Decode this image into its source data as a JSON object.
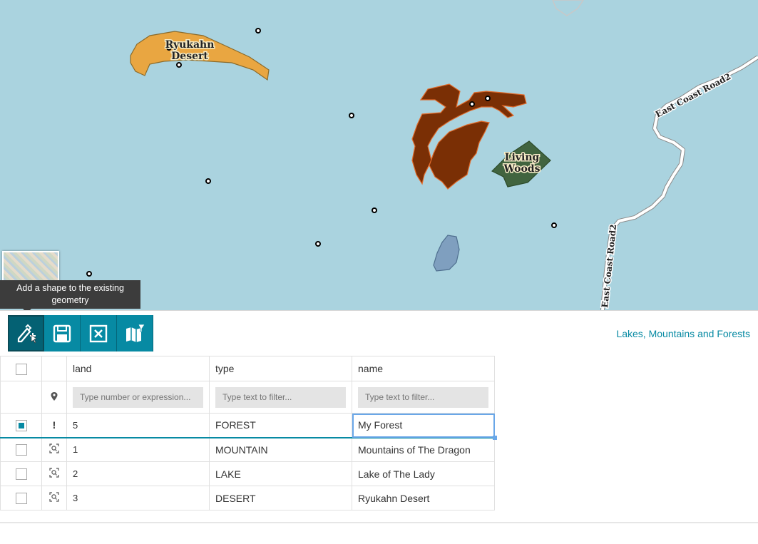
{
  "map": {
    "labels": {
      "desert": [
        "Ryukahn",
        "Desert"
      ],
      "woods": [
        "Living",
        "Woods"
      ],
      "road_top": "East Coast Road2",
      "road_side": "East Coast Road2"
    },
    "colors": {
      "water": "#aad3df",
      "desert": "#e9a641",
      "forest": "#7a2f05",
      "woods": "#41643f",
      "lake": "#7f9fbf"
    }
  },
  "tooltip": {
    "text": "Add a shape to the existing geometry"
  },
  "toolbar": {
    "buttons": [
      {
        "icon": "add-shape-icon"
      },
      {
        "icon": "save-icon"
      },
      {
        "icon": "cancel-icon"
      },
      {
        "icon": "map-filter-icon"
      }
    ]
  },
  "layer_title": "Lakes, Mountains and Forests",
  "grid": {
    "columns": [
      "land",
      "type",
      "name"
    ],
    "filters": {
      "land_placeholder": "Type number or expression...",
      "type_placeholder": "Type text to filter...",
      "name_placeholder": "Type text to filter..."
    },
    "rows": [
      {
        "land": "5",
        "type": "FOREST",
        "name": "My Forest",
        "status": "!",
        "selected": true
      },
      {
        "land": "1",
        "type": "MOUNTAIN",
        "name": "Mountains of The Dragon",
        "selected": false
      },
      {
        "land": "2",
        "type": "LAKE",
        "name": "Lake of The Lady",
        "selected": false
      },
      {
        "land": "3",
        "type": "DESERT",
        "name": "Ryukahn Desert",
        "selected": false
      }
    ]
  }
}
